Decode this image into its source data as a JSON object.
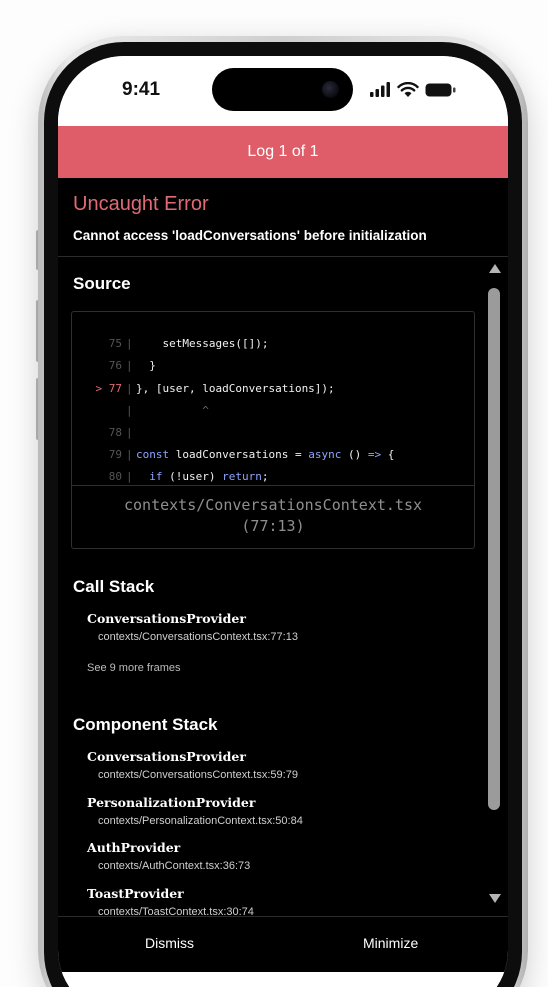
{
  "status_bar": {
    "time": "9:41",
    "icons": [
      "signal-icon",
      "wifi-icon",
      "battery-icon"
    ]
  },
  "log_header": {
    "label": "Log 1 of 1"
  },
  "error": {
    "title": "Uncaught Error",
    "message": "Cannot access 'loadConversations' before initialization"
  },
  "source": {
    "title": "Source",
    "lines": [
      {
        "num": "75",
        "bar": "|",
        "code": "    setMessages([]);",
        "active": false
      },
      {
        "num": "76",
        "bar": "|",
        "code": "  }",
        "active": false
      },
      {
        "num": "> 77",
        "bar": "|",
        "code": "}, [user, loadConversations]);",
        "active": true
      },
      {
        "num": "",
        "bar": "|",
        "code": "          ^",
        "active": false
      },
      {
        "num": "78",
        "bar": "|",
        "code": "",
        "active": false
      },
      {
        "num": "79",
        "bar": "|",
        "code": "const loadConversations = async () => {",
        "active": false
      },
      {
        "num": "80",
        "bar": "|",
        "code": "  if (!user) return;",
        "active": false
      }
    ],
    "file_path": "contexts/ConversationsContext.tsx",
    "file_position": "(77:13)"
  },
  "call_stack": {
    "title": "Call Stack",
    "frames": [
      {
        "name": "ConversationsProvider",
        "location": "contexts/ConversationsContext.tsx:77:13"
      }
    ],
    "see_more": "See 9 more frames"
  },
  "component_stack": {
    "title": "Component Stack",
    "frames": [
      {
        "name": "ConversationsProvider",
        "location": "contexts/ConversationsContext.tsx:59:79"
      },
      {
        "name": "PersonalizationProvider",
        "location": "contexts/PersonalizationContext.tsx:50:84"
      },
      {
        "name": "AuthProvider",
        "location": "contexts/AuthContext.tsx:36:73"
      },
      {
        "name": "ToastProvider",
        "location": "contexts/ToastContext.tsx:30:74"
      }
    ]
  },
  "footer": {
    "dismiss_label": "Dismiss",
    "minimize_label": "Minimize"
  },
  "colors": {
    "header_bg": "#de5d68",
    "error_title": "#e06a76",
    "keyword": "#8da4ff",
    "background": "#000000"
  }
}
